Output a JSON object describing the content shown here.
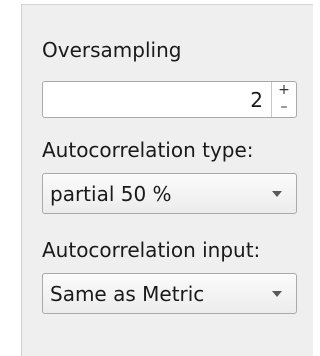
{
  "oversampling": {
    "label": "Oversampling",
    "value": "2",
    "increment_symbol": "+",
    "decrement_symbol": "–"
  },
  "autocorrelation_type": {
    "label": "Autocorrelation type:",
    "selected": "partial 50 %"
  },
  "autocorrelation_input": {
    "label": "Autocorrelation input:",
    "selected": "Same as Metric"
  }
}
